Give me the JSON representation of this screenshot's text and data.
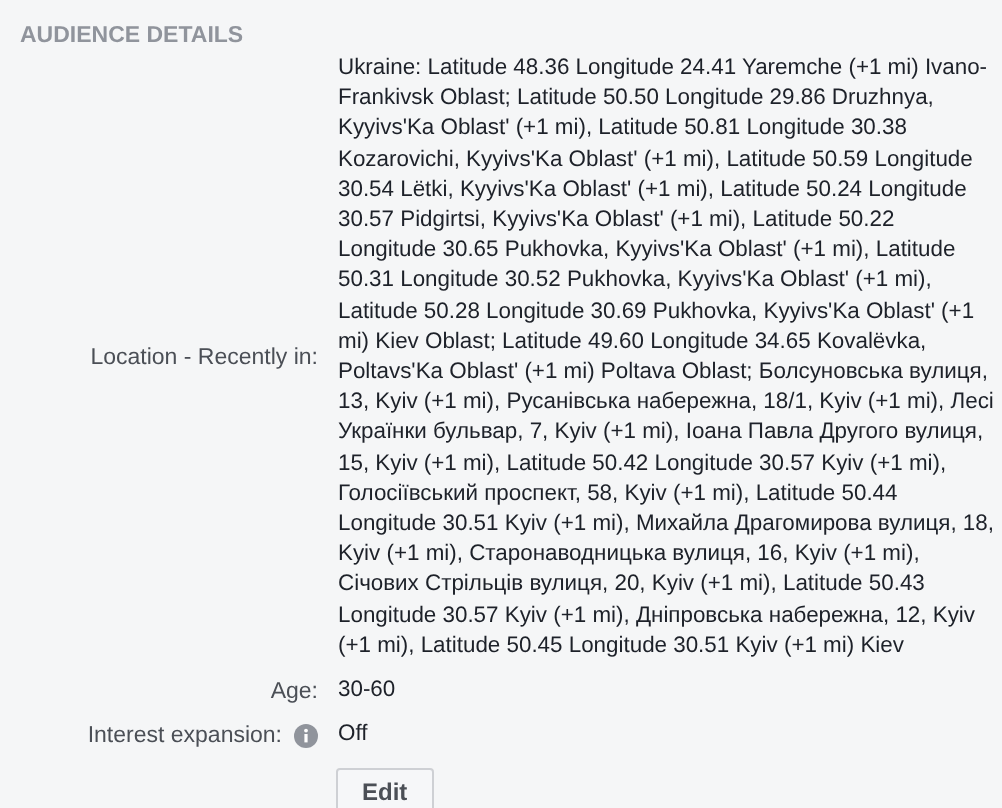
{
  "section": {
    "title": "AUDIENCE DETAILS"
  },
  "details": [
    {
      "kind": "text",
      "label": "Location - Recently in:",
      "value": "Ukraine: Latitude 48.36 Longitude 24.41 Yaremche (+1 mi) Ivano-Frankivsk Oblast; Latitude 50.50 Longitude 29.86 Druzhnya, Kyyivs'Ka Oblast' (+1 mi), Latitude 50.81 Longitude 30.38 Kozarovichi, Kyyivs'Ka Oblast' (+1 mi), Latitude 50.59 Longitude 30.54 Lëtki, Kyyivs'Ka Oblast' (+1 mi), Latitude 50.24 Longitude 30.57 Pidgirtsi, Kyyivs'Ka Oblast' (+1 mi), Latitude 50.22 Longitude 30.65 Pukhovka, Kyyivs'Ka Oblast' (+1 mi), Latitude 50.31 Longitude 30.52 Pukhovka, Kyyivs'Ka Oblast' (+1 mi), Latitude 50.28 Longitude 30.69 Pukhovka, Kyyivs'Ka Oblast' (+1 mi) Kiev Oblast; Latitude 49.60 Longitude 34.65 Kovalëvka, Poltavs'Ka Oblast' (+1 mi) Poltava Oblast; Болсуновська вулиця, 13, Kyiv (+1 mi), Русанівська набережна, 18/1, Kyiv (+1 mi), Лесі Українки бульвар, 7, Kyiv (+1 mi), Іоана Павла Другого вулиця, 15, Kyiv (+1 mi), Latitude 50.42 Longitude 30.57 Kyiv (+1 mi), Голосіївський проспект, 58, Kyiv (+1 mi), Latitude 50.44 Longitude 30.51 Kyiv (+1 mi), Михайла Драгомирова вулиця, 18, Kyiv (+1 mi), Старонаводницька вулиця, 16, Kyiv (+1 mi), Січових Стрільців вулиця, 20, Kyiv (+1 mi), Latitude 50.43 Longitude 30.57 Kyiv (+1 mi), Дніпровська набережна, 12, Kyiv (+1 mi), Latitude 50.45 Longitude 30.51 Kyiv (+1 mi) Kiev"
    },
    {
      "kind": "text",
      "label": "Age:",
      "value": "30-60"
    },
    {
      "kind": "info",
      "label": "Interest expansion:",
      "value": "Off"
    }
  ],
  "buttons": [
    "Edit"
  ]
}
